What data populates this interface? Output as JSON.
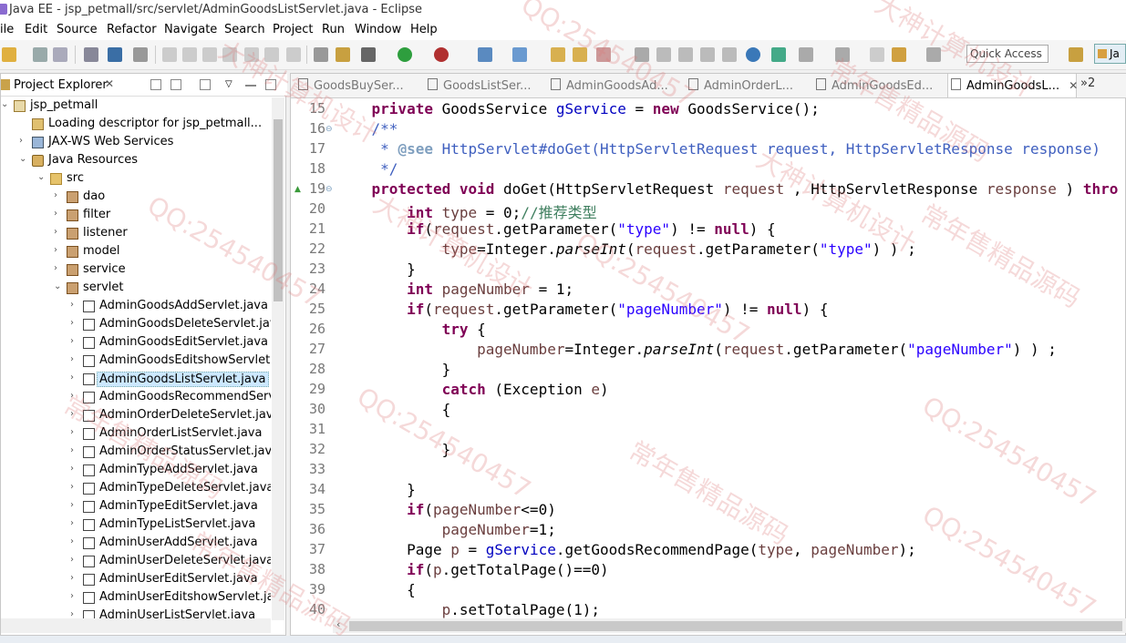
{
  "window": {
    "title": "Java EE - jsp_petmall/src/servlet/AdminGoodsListServlet.java - Eclipse"
  },
  "menu": [
    "ile",
    "Edit",
    "Source",
    "Refactor",
    "Navigate",
    "Search",
    "Project",
    "Run",
    "Window",
    "Help"
  ],
  "toolbar": {
    "quick_access_placeholder": "Quick Access",
    "perspective_label": "Ja"
  },
  "project_explorer": {
    "title": "Project Explorer",
    "close_glyph": "✕",
    "tree": [
      {
        "label": "jsp_petmall",
        "icon": "project-icon",
        "arrow": "⌄",
        "indent": 0
      },
      {
        "label": "Loading descriptor for jsp_petmall...",
        "icon": "loading-icon",
        "arrow": "",
        "indent": 1
      },
      {
        "label": "JAX-WS Web Services",
        "icon": "webservices-icon",
        "arrow": "›",
        "indent": 1
      },
      {
        "label": "Java Resources",
        "icon": "java-resources-icon",
        "arrow": "⌄",
        "indent": 1
      },
      {
        "label": "src",
        "icon": "source-folder-icon",
        "arrow": "⌄",
        "indent": 2
      },
      {
        "label": "dao",
        "icon": "package-icon",
        "arrow": "›",
        "indent": 3
      },
      {
        "label": "filter",
        "icon": "package-icon",
        "arrow": "›",
        "indent": 3
      },
      {
        "label": "listener",
        "icon": "package-icon",
        "arrow": "›",
        "indent": 3
      },
      {
        "label": "model",
        "icon": "package-icon",
        "arrow": "›",
        "indent": 3
      },
      {
        "label": "service",
        "icon": "package-icon",
        "arrow": "›",
        "indent": 3
      },
      {
        "label": "servlet",
        "icon": "package-icon",
        "arrow": "⌄",
        "indent": 3
      },
      {
        "label": "AdminGoodsAddServlet.java",
        "icon": "java-file-icon",
        "arrow": "›",
        "indent": 4
      },
      {
        "label": "AdminGoodsDeleteServlet.java",
        "icon": "java-file-icon",
        "arrow": "›",
        "indent": 4
      },
      {
        "label": "AdminGoodsEditServlet.java",
        "icon": "java-file-icon",
        "arrow": "›",
        "indent": 4
      },
      {
        "label": "AdminGoodsEditshowServlet.jav",
        "icon": "java-file-icon",
        "arrow": "›",
        "indent": 4
      },
      {
        "label": "AdminGoodsListServlet.java",
        "icon": "java-file-icon",
        "arrow": "›",
        "indent": 4,
        "selected": true
      },
      {
        "label": "AdminGoodsRecommendServle",
        "icon": "java-file-icon",
        "arrow": "›",
        "indent": 4
      },
      {
        "label": "AdminOrderDeleteServlet.java",
        "icon": "java-file-icon",
        "arrow": "›",
        "indent": 4
      },
      {
        "label": "AdminOrderListServlet.java",
        "icon": "java-file-icon",
        "arrow": "›",
        "indent": 4
      },
      {
        "label": "AdminOrderStatusServlet.java",
        "icon": "java-file-icon",
        "arrow": "›",
        "indent": 4
      },
      {
        "label": "AdminTypeAddServlet.java",
        "icon": "java-file-icon",
        "arrow": "›",
        "indent": 4
      },
      {
        "label": "AdminTypeDeleteServlet.java",
        "icon": "java-file-icon",
        "arrow": "›",
        "indent": 4
      },
      {
        "label": "AdminTypeEditServlet.java",
        "icon": "java-file-icon",
        "arrow": "›",
        "indent": 4
      },
      {
        "label": "AdminTypeListServlet.java",
        "icon": "java-file-icon",
        "arrow": "›",
        "indent": 4
      },
      {
        "label": "AdminUserAddServlet.java",
        "icon": "java-file-icon",
        "arrow": "›",
        "indent": 4
      },
      {
        "label": "AdminUserDeleteServlet.java",
        "icon": "java-file-icon",
        "arrow": "›",
        "indent": 4
      },
      {
        "label": "AdminUserEditServlet.java",
        "icon": "java-file-icon",
        "arrow": "›",
        "indent": 4
      },
      {
        "label": "AdminUserEditshowServlet.java",
        "icon": "java-file-icon",
        "arrow": "›",
        "indent": 4
      },
      {
        "label": "AdminUserListServlet.java",
        "icon": "java-file-icon",
        "arrow": "›",
        "indent": 4
      }
    ]
  },
  "editor": {
    "tabs": [
      "GoodsBuySer...",
      "GoodsListSer...",
      "AdminGoodsAd...",
      "AdminOrderL...",
      "AdminGoodsEd...",
      "AdminGoodsL..."
    ],
    "active_tab": "AdminGoodsL...",
    "active_tab_close": "✕",
    "overflow": "»2",
    "lines": [
      {
        "n": "15",
        "tokens": [
          [
            "",
            "    "
          ],
          [
            "kw",
            "private"
          ],
          [
            "",
            " GoodsService "
          ],
          [
            "fld",
            "gService"
          ],
          [
            "",
            " = "
          ],
          [
            "kw",
            "new"
          ],
          [
            "",
            " GoodsService();"
          ]
        ]
      },
      {
        "n": "16",
        "fold": "⊖",
        "tokens": [
          [
            "jd",
            "    /**"
          ]
        ]
      },
      {
        "n": "17",
        "tokens": [
          [
            "jd",
            "     * "
          ],
          [
            "jdt",
            "@see"
          ],
          [
            "jd",
            " HttpServlet#doGet(HttpServletRequest request, HttpServletResponse response)"
          ]
        ]
      },
      {
        "n": "18",
        "tokens": [
          [
            "jd",
            "     */"
          ]
        ]
      },
      {
        "n": "19",
        "fold": "⊖",
        "override": "▲",
        "tokens": [
          [
            "",
            "    "
          ],
          [
            "kw",
            "protected"
          ],
          [
            "",
            " "
          ],
          [
            "kw",
            "void"
          ],
          [
            "",
            " doGet(HttpServletRequest "
          ],
          [
            "var",
            "request"
          ],
          [
            "",
            " , HttpServletResponse "
          ],
          [
            "var",
            "response"
          ],
          [
            "",
            " ) "
          ],
          [
            "kw",
            "thro"
          ]
        ]
      },
      {
        "n": "20",
        "tokens": [
          [
            "",
            "        "
          ],
          [
            "kw",
            "int"
          ],
          [
            "",
            " "
          ],
          [
            "var",
            "type"
          ],
          [
            "",
            " = 0;"
          ],
          [
            "cmt",
            "//推荐类型"
          ]
        ]
      },
      {
        "n": "21",
        "tokens": [
          [
            "",
            "        "
          ],
          [
            "kw",
            "if"
          ],
          [
            "",
            "("
          ],
          [
            "var",
            "request"
          ],
          [
            "",
            ".getParameter("
          ],
          [
            "str",
            "\"type\""
          ],
          [
            "",
            ") != "
          ],
          [
            "kw",
            "null"
          ],
          [
            "",
            ") {"
          ]
        ]
      },
      {
        "n": "22",
        "tokens": [
          [
            "",
            "            "
          ],
          [
            "var",
            "type"
          ],
          [
            "",
            "=Integer."
          ],
          [
            "it",
            "parseInt"
          ],
          [
            "",
            "("
          ],
          [
            "var",
            "request"
          ],
          [
            "",
            ".getParameter("
          ],
          [
            "str",
            "\"type\""
          ],
          [
            "",
            ") ) ;"
          ]
        ]
      },
      {
        "n": "23",
        "tokens": [
          [
            "",
            "        }"
          ]
        ]
      },
      {
        "n": "24",
        "tokens": [
          [
            "",
            "        "
          ],
          [
            "kw",
            "int"
          ],
          [
            "",
            " "
          ],
          [
            "var",
            "pageNumber"
          ],
          [
            "",
            " = 1;"
          ]
        ]
      },
      {
        "n": "25",
        "tokens": [
          [
            "",
            "        "
          ],
          [
            "kw",
            "if"
          ],
          [
            "",
            "("
          ],
          [
            "var",
            "request"
          ],
          [
            "",
            ".getParameter("
          ],
          [
            "str",
            "\"pageNumber\""
          ],
          [
            "",
            ") != "
          ],
          [
            "kw",
            "null"
          ],
          [
            "",
            ") {"
          ]
        ]
      },
      {
        "n": "26",
        "tokens": [
          [
            "",
            "            "
          ],
          [
            "kw",
            "try"
          ],
          [
            "",
            " {"
          ]
        ]
      },
      {
        "n": "27",
        "tokens": [
          [
            "",
            "                "
          ],
          [
            "var",
            "pageNumber"
          ],
          [
            "",
            "=Integer."
          ],
          [
            "it",
            "parseInt"
          ],
          [
            "",
            "("
          ],
          [
            "var",
            "request"
          ],
          [
            "",
            ".getParameter("
          ],
          [
            "str",
            "\"pageNumber\""
          ],
          [
            "",
            ") ) ;"
          ]
        ]
      },
      {
        "n": "28",
        "tokens": [
          [
            "",
            "            }"
          ]
        ]
      },
      {
        "n": "29",
        "tokens": [
          [
            "",
            "            "
          ],
          [
            "kw",
            "catch"
          ],
          [
            "",
            " (Exception "
          ],
          [
            "var",
            "e"
          ],
          [
            "",
            ")"
          ]
        ]
      },
      {
        "n": "30",
        "tokens": [
          [
            "",
            "            {"
          ]
        ]
      },
      {
        "n": "31",
        "tokens": [
          [
            "",
            ""
          ]
        ]
      },
      {
        "n": "32",
        "tokens": [
          [
            "",
            "            }"
          ]
        ]
      },
      {
        "n": "33",
        "tokens": [
          [
            "",
            ""
          ]
        ]
      },
      {
        "n": "34",
        "tokens": [
          [
            "",
            "        }"
          ]
        ]
      },
      {
        "n": "35",
        "tokens": [
          [
            "",
            "        "
          ],
          [
            "kw",
            "if"
          ],
          [
            "",
            "("
          ],
          [
            "var",
            "pageNumber"
          ],
          [
            "",
            "<=0)"
          ]
        ]
      },
      {
        "n": "36",
        "tokens": [
          [
            "",
            "            "
          ],
          [
            "var",
            "pageNumber"
          ],
          [
            "",
            "=1;"
          ]
        ]
      },
      {
        "n": "37",
        "tokens": [
          [
            "",
            "        Page "
          ],
          [
            "var",
            "p"
          ],
          [
            "",
            " = "
          ],
          [
            "fld",
            "gService"
          ],
          [
            "",
            ".getGoodsRecommendPage("
          ],
          [
            "var",
            "type"
          ],
          [
            "",
            ", "
          ],
          [
            "var",
            "pageNumber"
          ],
          [
            "",
            ");"
          ]
        ]
      },
      {
        "n": "38",
        "tokens": [
          [
            "",
            "        "
          ],
          [
            "kw",
            "if"
          ],
          [
            "",
            "("
          ],
          [
            "var",
            "p"
          ],
          [
            "",
            ".getTotalPage()==0)"
          ]
        ]
      },
      {
        "n": "39",
        "tokens": [
          [
            "",
            "        {"
          ]
        ]
      },
      {
        "n": "40",
        "tokens": [
          [
            "",
            "            "
          ],
          [
            "var",
            "p"
          ],
          [
            "",
            ".setTotalPage(1);"
          ]
        ]
      }
    ]
  },
  "watermark": [
    "QQ:254540457",
    "大神计算机设计",
    "常年售精品源码"
  ]
}
